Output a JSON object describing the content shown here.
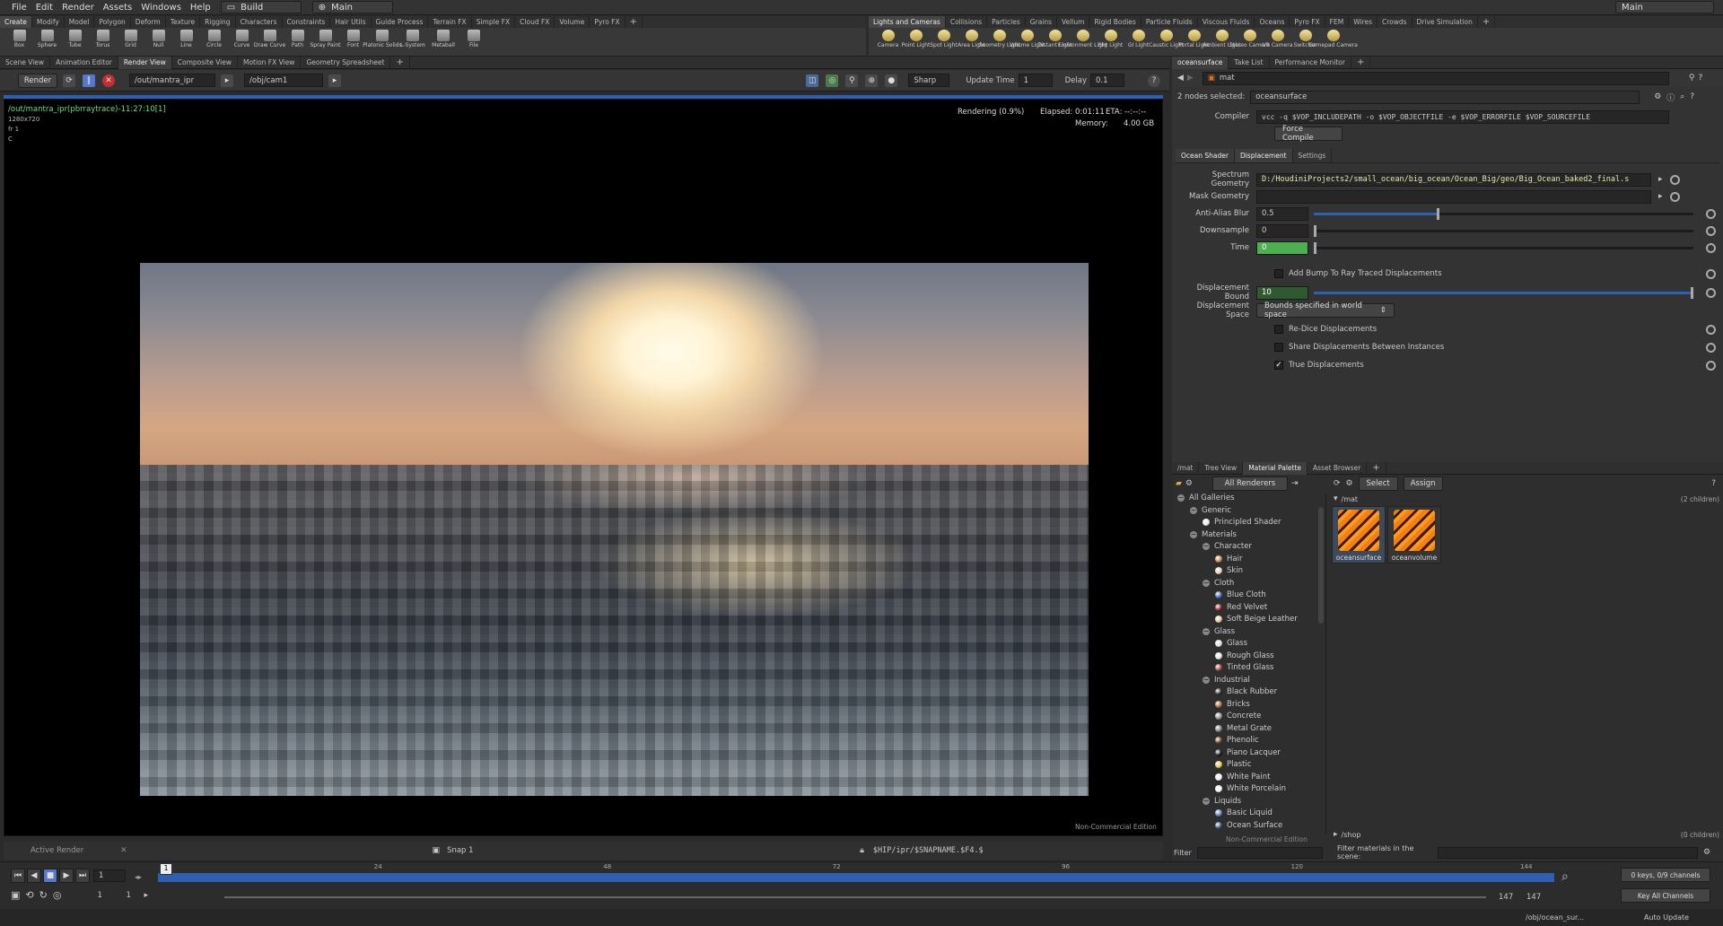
{
  "menubar": {
    "items": [
      "File",
      "Edit",
      "Render",
      "Assets",
      "Windows",
      "Help"
    ],
    "desktop": "Build",
    "context": "Main",
    "right_context": "Main"
  },
  "shelf_tabs_left": [
    "Create",
    "Modify",
    "Model",
    "Polygon",
    "Deform",
    "Texture",
    "Rigging",
    "Characters",
    "Constraints",
    "Hair Utils",
    "Guide Process",
    "Terrain FX",
    "Simple FX",
    "Cloud FX",
    "Volume",
    "Pyro FX"
  ],
  "shelf_tabs_right": [
    "Lights and Cameras",
    "Collisions",
    "Particles",
    "Grains",
    "Vellum",
    "Rigid Bodies",
    "Particle Fluids",
    "Viscous Fluids",
    "Oceans",
    "Pyro FX",
    "FEM",
    "Wires",
    "Crowds",
    "Drive Simulation"
  ],
  "tools_left": [
    "Box",
    "Sphere",
    "Tube",
    "Torus",
    "Grid",
    "Null",
    "Line",
    "Circle",
    "Curve",
    "Draw Curve",
    "Path",
    "Spray Paint",
    "Font",
    "Platonic Solids",
    "L-System",
    "Metaball",
    "File"
  ],
  "tools_right": [
    "Camera",
    "Point Light",
    "Spot Light",
    "Area Light",
    "Geometry Light",
    "Volume Light",
    "Distant Light",
    "Environment Light",
    "Sky Light",
    "GI Light",
    "Caustic Light",
    "Portal Light",
    "Ambient Light",
    "Stereo Camera",
    "VR Camera",
    "Switcher",
    "Gamepad Camera"
  ],
  "pane_tabs_left": [
    "Scene View",
    "Animation Editor",
    "Render View",
    "Composite View",
    "Motion FX View",
    "Geometry Spreadsheet"
  ],
  "render_toolbar": {
    "render_label": "Render",
    "rop_path": "/out/mantra_ipr",
    "camera_path": "/obj/cam1",
    "quality": "Sharp",
    "update_time_label": "Update Time",
    "update_time": "1",
    "delay_label": "Delay",
    "delay": "0.1"
  },
  "viewport": {
    "title": "/out/mantra_ipr(pbrraytrace)-11:27:10[1]",
    "resolution": "1280x720",
    "frame": "fr 1",
    "channel": "C",
    "status": "Rendering (0.9%)",
    "elapsed": "Elapsed: 0:01:11",
    "eta": "ETA: --:--:--",
    "memory_label": "Memory:",
    "memory": "4.00 GB",
    "watermark": "Non-Commercial Edition"
  },
  "viewport_bottom": {
    "active_render": "Active Render",
    "snap": "Snap 1",
    "snap_path": "$HIP/ipr/$SNAPNAME.$F4.$"
  },
  "right_tabs": [
    "oceansurface",
    "Take List",
    "Performance Monitor"
  ],
  "right_path": "mat",
  "params": {
    "nodes_selected": "2 nodes selected:",
    "node_name": "oceansurface",
    "compiler_label": "Compiler",
    "compiler_value": "vcc -q $VOP_INCLUDEPATH -o $VOP_OBJECTFILE -e $VOP_ERRORFILE $VOP_SOURCEFILE",
    "force_compile": "Force Compile",
    "tabs": [
      "Ocean Shader",
      "Displacement",
      "Settings"
    ],
    "spectrum_label": "Spectrum Geometry",
    "spectrum_value": "D:/HoudiniProjects2/small_ocean/big_ocean/Ocean_Big/geo/Big_Ocean_baked2_final.s",
    "mask_label": "Mask Geometry",
    "mask_value": "",
    "antialias_label": "Anti-Alias Blur",
    "antialias_value": "0.5",
    "antialias_fraction": 0.33,
    "downsample_label": "Downsample",
    "downsample_value": "0",
    "time_label": "Time",
    "time_value": "0",
    "bump_label": "Add Bump To Ray Traced Displacements",
    "bump_checked": false,
    "bound_label": "Displacement Bound",
    "bound_value": "10",
    "bound_fraction": 1.0,
    "space_label": "Displacement Space",
    "space_value": "Bounds specified in world space",
    "redice_label": "Re-Dice Displacements",
    "redice_checked": false,
    "share_label": "Share Displacements Between Instances",
    "share_checked": false,
    "true_label": "True Displacements",
    "true_checked": true
  },
  "bottom_tabs": [
    "/mat",
    "Tree View",
    "Material Palette",
    "Asset Browser"
  ],
  "palette": {
    "renderers": "All Renderers",
    "select": "Select",
    "assign": "Assign",
    "mat_path": "/mat",
    "children": "(2 children)",
    "shop_path": "/shop",
    "shop_children": "(0 children)",
    "filter_label": "Filter",
    "filter_scene_label": "Filter materials in the scene:",
    "watermark": "Non-Commercial Edition",
    "materials": [
      "oceansurface",
      "oceanvolume"
    ]
  },
  "gallery": [
    {
      "label": "All Galleries",
      "level": 0,
      "type": "folder"
    },
    {
      "label": "Generic",
      "level": 1,
      "type": "folder"
    },
    {
      "label": "Principled Shader",
      "level": 2,
      "type": "item",
      "color": "#e8e8e8"
    },
    {
      "label": "Materials",
      "level": 1,
      "type": "folder"
    },
    {
      "label": "Character",
      "level": 2,
      "type": "folder"
    },
    {
      "label": "Hair",
      "level": 3,
      "type": "item",
      "color": "#c08050"
    },
    {
      "label": "Skin",
      "level": 3,
      "type": "item",
      "color": "#e8c8b0"
    },
    {
      "label": "Cloth",
      "level": 2,
      "type": "folder"
    },
    {
      "label": "Blue Cloth",
      "level": 3,
      "type": "item",
      "color": "#3a5fa8"
    },
    {
      "label": "Red Velvet",
      "level": 3,
      "type": "item",
      "color": "#8a1a1a"
    },
    {
      "label": "Soft Beige Leather",
      "level": 3,
      "type": "item",
      "color": "#d8c4a0"
    },
    {
      "label": "Glass",
      "level": 2,
      "type": "folder"
    },
    {
      "label": "Glass",
      "level": 3,
      "type": "item",
      "color": "#d0d8e0"
    },
    {
      "label": "Rough Glass",
      "level": 3,
      "type": "item",
      "color": "#e0e0e0"
    },
    {
      "label": "Tinted Glass",
      "level": 3,
      "type": "item",
      "color": "#9a3a3a"
    },
    {
      "label": "Industrial",
      "level": 2,
      "type": "folder"
    },
    {
      "label": "Black Rubber",
      "level": 3,
      "type": "item",
      "color": "#222"
    },
    {
      "label": "Bricks",
      "level": 3,
      "type": "item",
      "color": "#9a5a3a"
    },
    {
      "label": "Concrete",
      "level": 3,
      "type": "item",
      "color": "#888"
    },
    {
      "label": "Metal Grate",
      "level": 3,
      "type": "item",
      "color": "#777"
    },
    {
      "label": "Phenolic",
      "level": 3,
      "type": "item",
      "color": "#6a3a20"
    },
    {
      "label": "Piano Lacquer",
      "level": 3,
      "type": "item",
      "color": "#111"
    },
    {
      "label": "Plastic",
      "level": 3,
      "type": "item",
      "color": "#e0c040"
    },
    {
      "label": "White Paint",
      "level": 3,
      "type": "item",
      "color": "#eee"
    },
    {
      "label": "White Porcelain",
      "level": 3,
      "type": "item",
      "color": "#f4f4f4"
    },
    {
      "label": "Liquids",
      "level": 2,
      "type": "folder"
    },
    {
      "label": "Basic Liquid",
      "level": 3,
      "type": "item",
      "color": "#5a7ab0"
    },
    {
      "label": "Ocean Surface",
      "level": 3,
      "type": "item",
      "color": "#2a4a6a"
    }
  ],
  "timeline": {
    "current_frame": "1",
    "ticks": [
      "1",
      "24",
      "48",
      "72",
      "96",
      "120",
      "144"
    ],
    "start": "1",
    "start2": "1",
    "end": "147",
    "end2": "147",
    "keys": "0 keys, 0/9 channels",
    "key_all": "Key All Channels",
    "status_path": "/obj/ocean_sur...",
    "auto_update": "Auto Update"
  },
  "colors": {
    "accent_blue": "#2d5fb3",
    "time_green": "#4caf50",
    "field_bg": "#262626"
  }
}
